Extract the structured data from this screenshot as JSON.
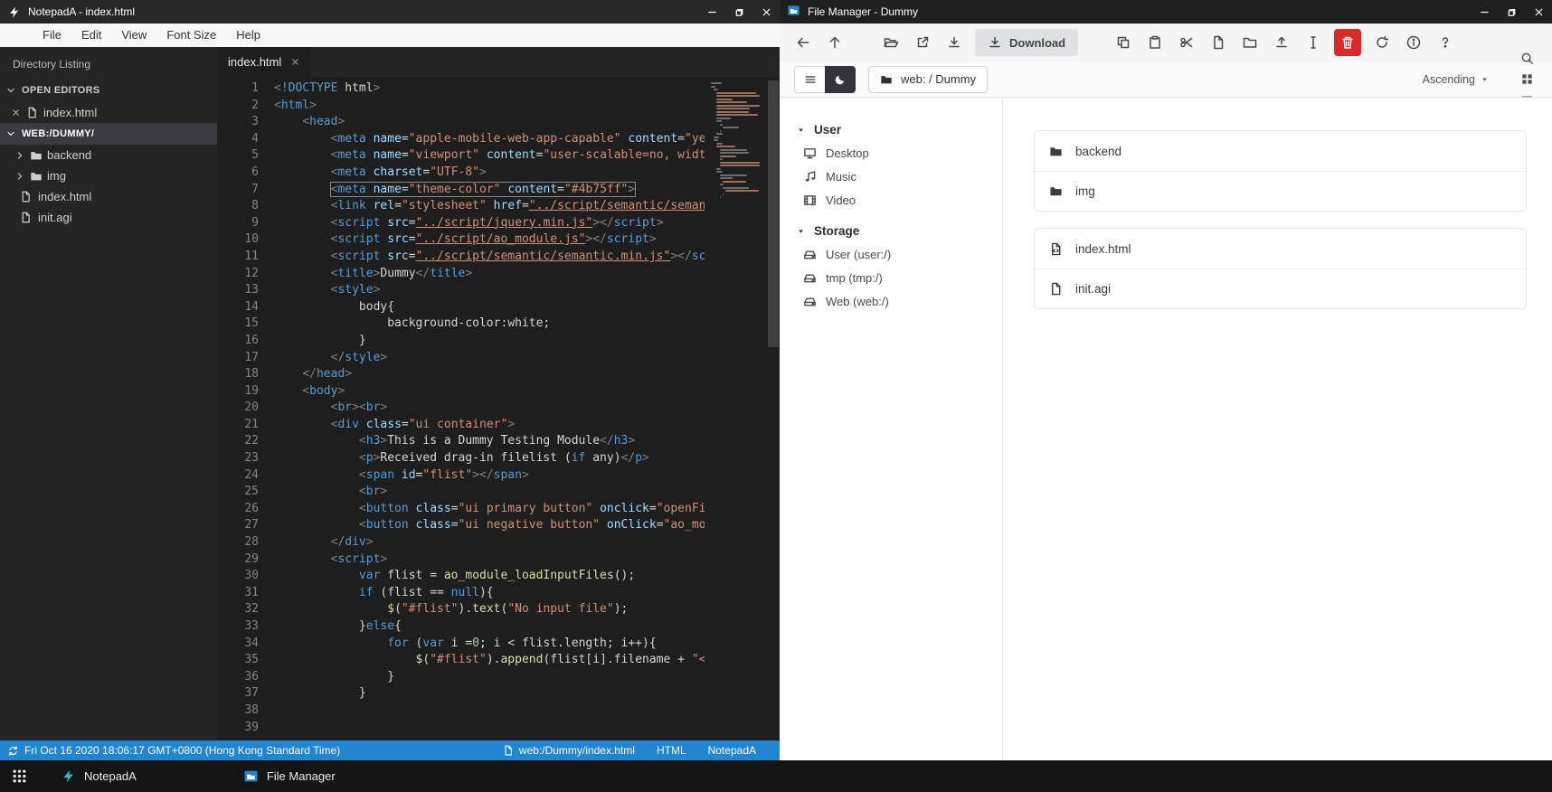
{
  "notepad": {
    "title": "NotepadA - index.html",
    "menu": [
      "File",
      "Edit",
      "View",
      "Font Size",
      "Help"
    ],
    "sidebar": {
      "header": "Directory Listing",
      "open_editors_label": "OPEN EDITORS",
      "open_editors": [
        {
          "name": "index.html"
        }
      ],
      "workspace": "WEB:/DUMMY/",
      "tree": [
        {
          "name": "backend",
          "type": "folder"
        },
        {
          "name": "img",
          "type": "folder"
        },
        {
          "name": "index.html",
          "type": "file"
        },
        {
          "name": "init.agi",
          "type": "file"
        }
      ]
    },
    "tab": "index.html",
    "highlighted_line": 7,
    "code_lines": [
      "<!DOCTYPE html>",
      "<html>",
      "    <head>",
      "        <meta name=\"apple-mobile-web-app-capable\" content=\"yes\">",
      "        <meta name=\"viewport\" content=\"user-scalable=no, width=device-width\">",
      "        <meta charset=\"UTF-8\">",
      "        <meta name=\"theme-color\" content=\"#4b75ff\">",
      "        <link rel=\"stylesheet\" href=\"../script/semantic/semantic.min.css\">",
      "        <script src=\"../script/jquery.min.js\"></script>",
      "        <script src=\"../script/ao_module.js\"></script>",
      "        <script src=\"../script/semantic/semantic.min.js\"></script>",
      "        <title>Dummy</title>",
      "        <style>",
      "            body{",
      "                background-color:white;",
      "            }",
      "        </style>",
      "    </head>",
      "    <body>",
      "        <br><br>",
      "        <div class=\"ui container\">",
      "            <h3>This is a Dummy Testing Module</h3>",
      "            <p>Received drag-in filelist (if any)</p>",
      "            <span id=\"flist\"></span>",
      "            <br>",
      "            <button class=\"ui primary button\" onclick=\"openFileSelector()\">Open</button>",
      "            <button class=\"ui negative button\" onClick=\"ao_module_close();\">Close</button>",
      "        </div>",
      "        <script>",
      "            var flist = ao_module_loadInputFiles();",
      "            if (flist == null){",
      "                $(\"#flist\").text(\"No input file\");",
      "            }else{",
      "                for (var i =0; i < flist.length; i++){",
      "                    $(\"#flist\").append(flist[i].filename + \"<br>\");",
      "                }",
      "            }",
      "",
      ""
    ],
    "status": {
      "time": "Fri Oct 16 2020 18:06:17 GMT+0800 (Hong Kong Standard Time)",
      "file": "web:/Dummy/index.html",
      "language": "HTML",
      "app": "NotepadA"
    }
  },
  "filemanager": {
    "title": "File Manager - Dummy",
    "toolbar": [
      {
        "icon": "arrow-left",
        "name": "back"
      },
      {
        "icon": "arrow-up",
        "name": "up"
      },
      {
        "type": "gap"
      },
      {
        "icon": "folder-open",
        "name": "open"
      },
      {
        "icon": "external-link",
        "name": "open-in-new-window"
      },
      {
        "icon": "download",
        "name": "download"
      },
      {
        "type": "button",
        "icon": "download",
        "label": "Download",
        "name": "download-labeled"
      },
      {
        "type": "gap"
      },
      {
        "icon": "copy",
        "name": "copy"
      },
      {
        "icon": "paste",
        "name": "paste"
      },
      {
        "icon": "cut",
        "name": "cut"
      },
      {
        "icon": "file",
        "name": "new-file"
      },
      {
        "icon": "folder",
        "name": "new-folder"
      },
      {
        "icon": "upload",
        "name": "upload"
      },
      {
        "icon": "ibeam",
        "name": "rename"
      },
      {
        "type": "danger",
        "icon": "trash",
        "name": "delete"
      },
      {
        "icon": "refresh",
        "name": "refresh"
      },
      {
        "icon": "info",
        "name": "properties"
      },
      {
        "icon": "question",
        "name": "help"
      }
    ],
    "breadcrumb": "web: / Dummy",
    "sort": "Ascending",
    "view_controls": [
      {
        "icon": "search",
        "name": "search",
        "dim": false
      },
      {
        "icon": "grid",
        "name": "grid-view",
        "dim": false
      },
      {
        "icon": "list",
        "name": "list-view",
        "dim": true
      }
    ],
    "sidebar": [
      {
        "label": "User",
        "items": [
          {
            "label": "Desktop",
            "icon": "monitor"
          },
          {
            "label": "Music",
            "icon": "music"
          },
          {
            "label": "Video",
            "icon": "film"
          }
        ]
      },
      {
        "label": "Storage",
        "items": [
          {
            "label": "User (user:/)",
            "icon": "hdd"
          },
          {
            "label": "tmp (tmp:/)",
            "icon": "hdd"
          },
          {
            "label": "Web (web:/)",
            "icon": "hdd"
          }
        ]
      }
    ],
    "file_groups": [
      [
        {
          "name": "backend",
          "icon": "folder-solid"
        },
        {
          "name": "img",
          "icon": "folder-solid"
        }
      ],
      [
        {
          "name": "index.html",
          "icon": "file-code"
        },
        {
          "name": "init.agi",
          "icon": "file"
        }
      ]
    ],
    "colors": {
      "accent": "#2185d0",
      "danger": "#db2828"
    }
  },
  "taskbar": {
    "items": [
      {
        "label": "NotepadA",
        "icon": "notepada"
      },
      {
        "label": "File Manager",
        "icon": "filemanager"
      }
    ]
  }
}
